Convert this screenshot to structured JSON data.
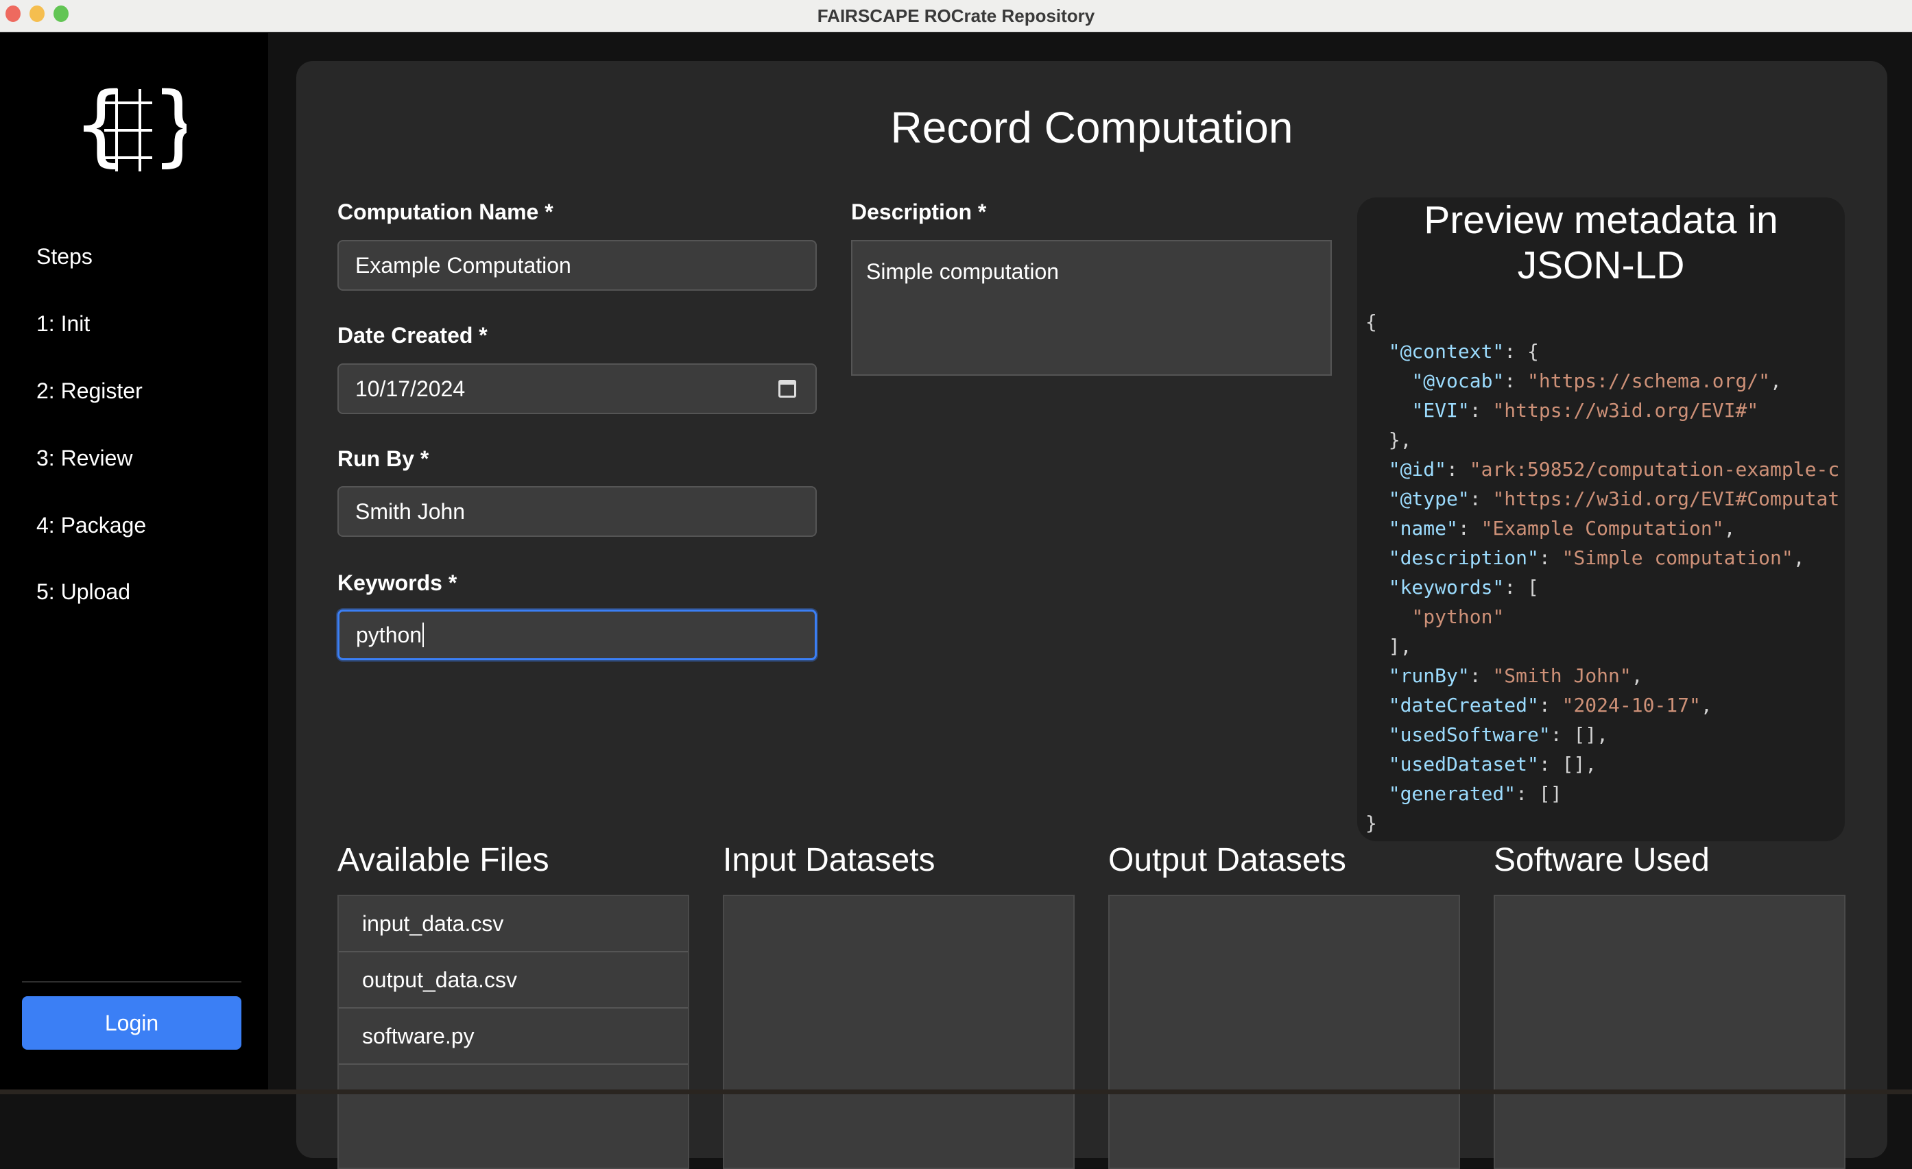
{
  "window": {
    "title": "FAIRSCAPE ROCrate Repository",
    "colors": {
      "close": "#ee6a5f",
      "minimize": "#f5be4f",
      "zoom": "#62c554"
    }
  },
  "sidebar": {
    "logo": "braces-grid-logo",
    "steps_label": "Steps",
    "items": [
      "1: Init",
      "2: Register",
      "3: Review",
      "4: Package",
      "5: Upload"
    ],
    "login_label": "Login",
    "accent": "#3b7ff5"
  },
  "form": {
    "heading": "Record Computation",
    "name_label": "Computation Name *",
    "name_value": "Example Computation",
    "date_label": "Date Created *",
    "date_value": "10/17/2024",
    "runby_label": "Run By *",
    "runby_value": "Smith John",
    "keywords_label": "Keywords *",
    "keywords_value": "python",
    "description_label": "Description *",
    "description_value": "Simple computation"
  },
  "preview": {
    "title": "Preview metadata in JSON-LD",
    "lines": [
      {
        "i": 0,
        "p": "{"
      },
      {
        "i": 1,
        "k": "\"@context\"",
        "p": ": {"
      },
      {
        "i": 2,
        "k": "\"@vocab\"",
        "p": ": ",
        "s": "\"https://schema.org/\"",
        "t": ","
      },
      {
        "i": 2,
        "k": "\"EVI\"",
        "p": ": ",
        "s": "\"https://w3id.org/EVI#\""
      },
      {
        "i": 1,
        "p": "},"
      },
      {
        "i": 1,
        "k": "\"@id\"",
        "p": ": ",
        "s": "\"ark:59852/computation-example-c"
      },
      {
        "i": 1,
        "k": "\"@type\"",
        "p": ": ",
        "s": "\"https://w3id.org/EVI#Computat"
      },
      {
        "i": 1,
        "k": "\"name\"",
        "p": ": ",
        "s": "\"Example Computation\"",
        "t": ","
      },
      {
        "i": 1,
        "k": "\"description\"",
        "p": ": ",
        "s": "\"Simple computation\"",
        "t": ","
      },
      {
        "i": 1,
        "k": "\"keywords\"",
        "p": ": ["
      },
      {
        "i": 2,
        "s": "\"python\""
      },
      {
        "i": 1,
        "p": "],"
      },
      {
        "i": 1,
        "k": "\"runBy\"",
        "p": ": ",
        "s": "\"Smith John\"",
        "t": ","
      },
      {
        "i": 1,
        "k": "\"dateCreated\"",
        "p": ": ",
        "s": "\"2024-10-17\"",
        "t": ","
      },
      {
        "i": 1,
        "k": "\"usedSoftware\"",
        "p": ": [],"
      },
      {
        "i": 1,
        "k": "\"usedDataset\"",
        "p": ": [],"
      },
      {
        "i": 1,
        "k": "\"generated\"",
        "p": ": []"
      },
      {
        "i": 0,
        "p": "}"
      }
    ]
  },
  "sections": {
    "available_files": {
      "title": "Available Files",
      "items": [
        "input_data.csv",
        "output_data.csv",
        "software.py"
      ]
    },
    "input_datasets": {
      "title": "Input Datasets"
    },
    "output_datasets": {
      "title": "Output Datasets"
    },
    "software_used": {
      "title": "Software Used"
    }
  }
}
